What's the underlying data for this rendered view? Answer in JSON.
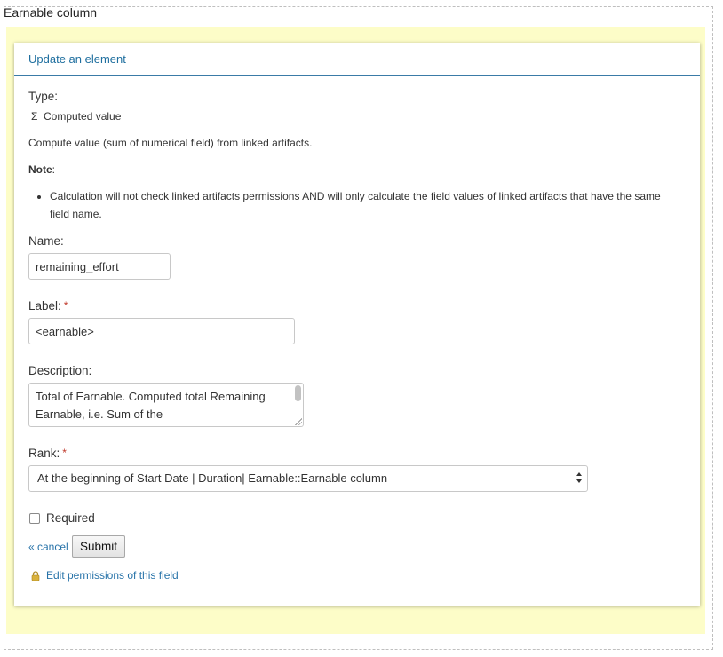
{
  "outer": {
    "title": "Earnable column"
  },
  "panel": {
    "title": "Update an element"
  },
  "type": {
    "label": "Type:",
    "icon": "sigma-icon",
    "value": "Computed value",
    "description": "Compute value (sum of numerical field) from linked artifacts."
  },
  "note": {
    "label": "Note",
    "colon": ":",
    "items": [
      "Calculation will not check linked artifacts permissions AND will only calculate the field values of linked artifacts that have the same field name."
    ]
  },
  "name": {
    "label": "Name:",
    "value": "remaining_effort"
  },
  "label_field": {
    "label": "Label:",
    "required_mark": "*",
    "value": "<earnable>"
  },
  "description": {
    "label": "Description:",
    "value": "Total of Earnable. Computed total Remaining Earnable, i.e. Sum of the"
  },
  "rank": {
    "label": "Rank:",
    "required_mark": "*",
    "selected": "At the beginning of Start Date | Duration| Earnable::Earnable column"
  },
  "required": {
    "label": "Required",
    "checked": false
  },
  "actions": {
    "cancel_label": "« cancel",
    "submit_label": "Submit"
  },
  "permissions": {
    "icon": "lock-icon",
    "label": "Edit permissions of this field"
  },
  "colors": {
    "accent": "#2672a8",
    "header_rule": "#3a7ba7",
    "highlight": "#fdfdc8",
    "required": "#c0392b"
  }
}
